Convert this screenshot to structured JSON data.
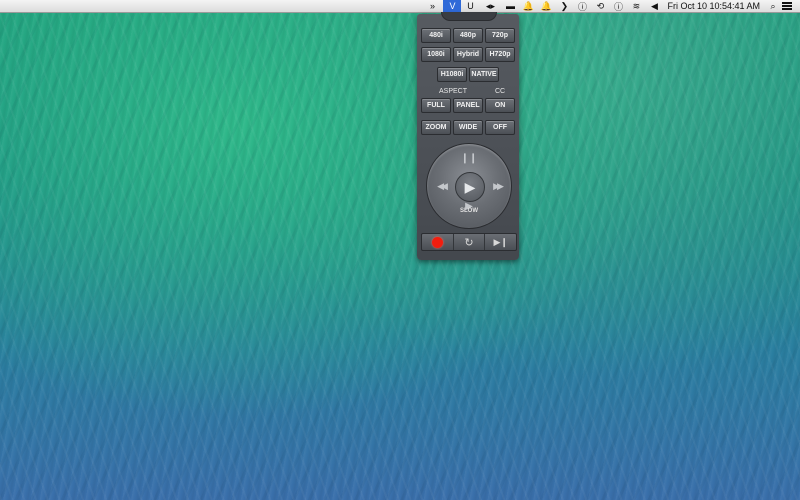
{
  "menubar": {
    "icons": [
      "»",
      "V",
      "U",
      "◂▸",
      "▬",
      "🔔",
      "🔔",
      "❯",
      "ⓘ",
      "⟲",
      "ⓘ",
      "≋",
      "◀"
    ],
    "clock": "Fri Oct 10  10:54:41 AM",
    "search_icon": "⌕"
  },
  "panel": {
    "row1": [
      "480i",
      "480p",
      "720p"
    ],
    "row2": [
      "1080i",
      "Hybrid",
      "H720p"
    ],
    "row3": [
      "H1080i",
      "NATIVE"
    ],
    "aspect_label": "ASPECT",
    "cc_label": "CC",
    "row4": [
      "FULL",
      "PANEL",
      "ON"
    ],
    "row5": [
      "ZOOM",
      "WIDE",
      "OFF"
    ],
    "dial": {
      "pause": "❙❙",
      "rewind": "◀◀",
      "play": "▶",
      "forward": "▶▶",
      "slow": "SLOW",
      "slow_arrow": "▶"
    },
    "bottom": {
      "replay": "↻",
      "skip": "▶❙"
    }
  },
  "colors": {
    "record": "#f31d0e",
    "active_menu": "#2f6ad8"
  }
}
